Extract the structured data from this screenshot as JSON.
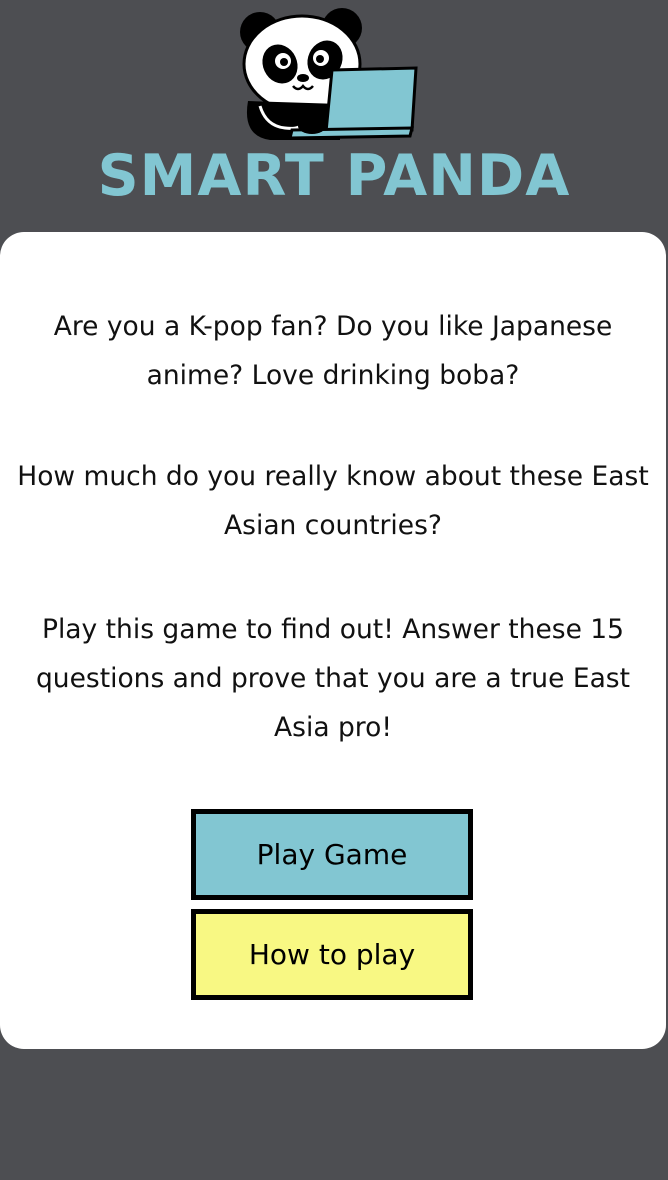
{
  "header": {
    "title": "SMART PANDA"
  },
  "intro": {
    "paragraph_1": "Are you a K-pop fan? Do you like Japanese anime? Love drinking boba?",
    "paragraph_2": "How much do you really know about these East Asian countries?",
    "paragraph_3": "Play this game to find out! Answer these 15 questions and prove that you are a true East Asia pro!"
  },
  "buttons": {
    "play_label": "Play Game",
    "how_label": "How to play"
  },
  "colors": {
    "background": "#4d4e52",
    "accent_teal": "#82c6d2",
    "accent_yellow": "#f8f883",
    "card": "#ffffff"
  },
  "icons": {
    "logo": "panda-with-laptop-icon"
  }
}
